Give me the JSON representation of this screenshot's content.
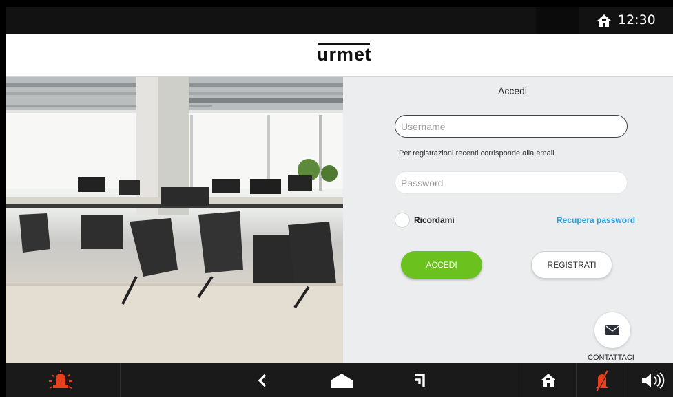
{
  "status_bar": {
    "time": "12:30",
    "icons": [
      "home-icon"
    ]
  },
  "header": {
    "logo_text": "urmet"
  },
  "login": {
    "title": "Accedi",
    "username": {
      "placeholder": "Username",
      "value": ""
    },
    "username_hint": "Per registrazioni recenti corrisponde alla email",
    "password": {
      "placeholder": "Password",
      "value": ""
    },
    "remember_label": "Ricordami",
    "remember_checked": false,
    "recover_link": "Recupera password",
    "login_button": "ACCEDI",
    "register_button": "REGISTRATI",
    "contact_label": "CONTATTACI"
  },
  "bottom_bar": {
    "icons": [
      "alarm-siren-icon",
      "back-chevron-icon",
      "home-shape-icon",
      "recent-apps-icon",
      "home-icon",
      "bell-muted-icon",
      "volume-icon"
    ]
  },
  "colors": {
    "accent_green": "#6bc21f",
    "link_blue": "#2a9fdb",
    "alert_red": "#e8401c",
    "bar_dark": "#1a1a1a"
  }
}
